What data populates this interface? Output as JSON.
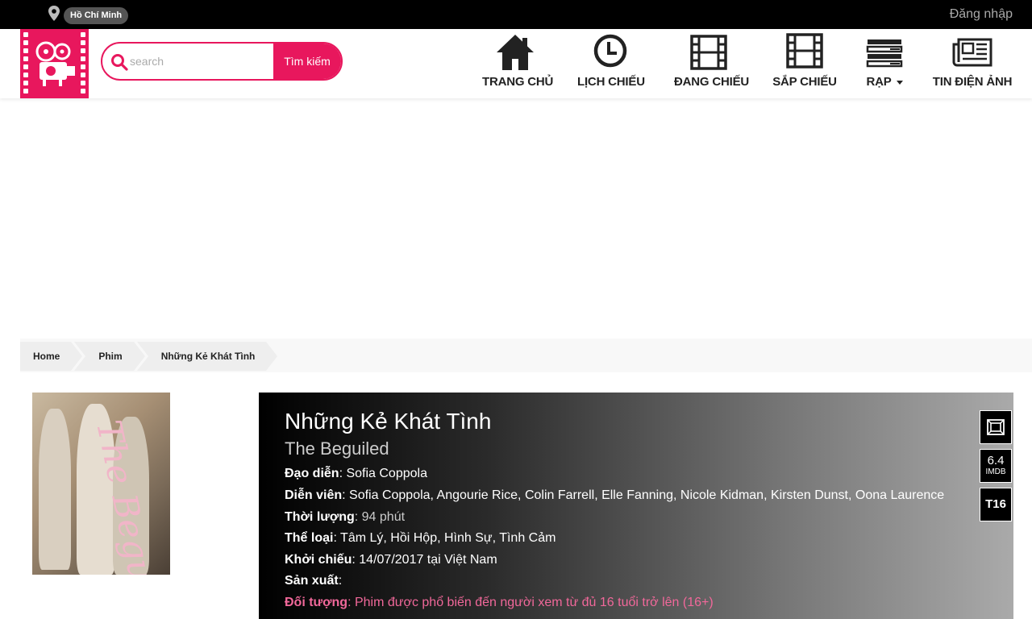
{
  "topbar": {
    "city": "Hồ Chí Minh",
    "login": "Đăng nhập",
    "icons": {
      "location": "location-pin-icon"
    }
  },
  "header": {
    "logo_icon": "film-projector-icon",
    "search": {
      "placeholder": "search",
      "value": "",
      "button": "Tìm kiếm",
      "icon": "search-icon"
    },
    "nav": [
      {
        "label": "TRANG CHỦ",
        "icon": "home-icon"
      },
      {
        "label": "LỊCH CHIẾU",
        "icon": "clock-icon"
      },
      {
        "label": "ĐANG CHIẾU",
        "icon": "film-strip-icon"
      },
      {
        "label": "SẮP CHIẾU",
        "icon": "film-strip-alt-icon"
      },
      {
        "label": "RẠP",
        "icon": "list-icon",
        "has_dropdown": true
      },
      {
        "label": "TIN ĐIỆN ẢNH",
        "icon": "newspaper-icon"
      }
    ]
  },
  "breadcrumb": [
    "Home",
    "Phim",
    "Những Kẻ Khát Tình"
  ],
  "poster": {
    "title_text": "The Beguiled"
  },
  "movie": {
    "title": "Những Kẻ Khát Tình",
    "original_title": "The Beguiled",
    "director": {
      "label": "Đạo diễn",
      "value": ": Sofia Coppola"
    },
    "cast": {
      "label": "Diễn viên",
      "value": ": Sofia Coppola, Angourie Rice, Colin Farrell, Elle Fanning, Nicole Kidman, Kirsten Dunst, Oona Laurence"
    },
    "duration": {
      "label": "Thời lượng",
      "value": ": 94 phút"
    },
    "genre": {
      "label": "Thể loại",
      "value": ": Tâm Lý, Hồi Hộp, Hình Sự, Tình Cảm"
    },
    "release": {
      "label": "Khởi chiếu",
      "value": ": 14/07/2017 tại Việt Nam"
    },
    "production": {
      "label": "Sản xuất",
      "value": ":"
    },
    "audience": {
      "label": "Đối tượng",
      "value": ": Phim được phổ biến đến người xem từ đủ 16 tuổi trở lên (16+)"
    },
    "badges": {
      "format_icon": "screen-format-icon",
      "imdb_score": "6.4",
      "imdb_label": "IMDB",
      "rating": "T16"
    }
  },
  "colors": {
    "brand": "#e8175d",
    "topbar": "#000000",
    "audience_text": "#f1689a"
  }
}
